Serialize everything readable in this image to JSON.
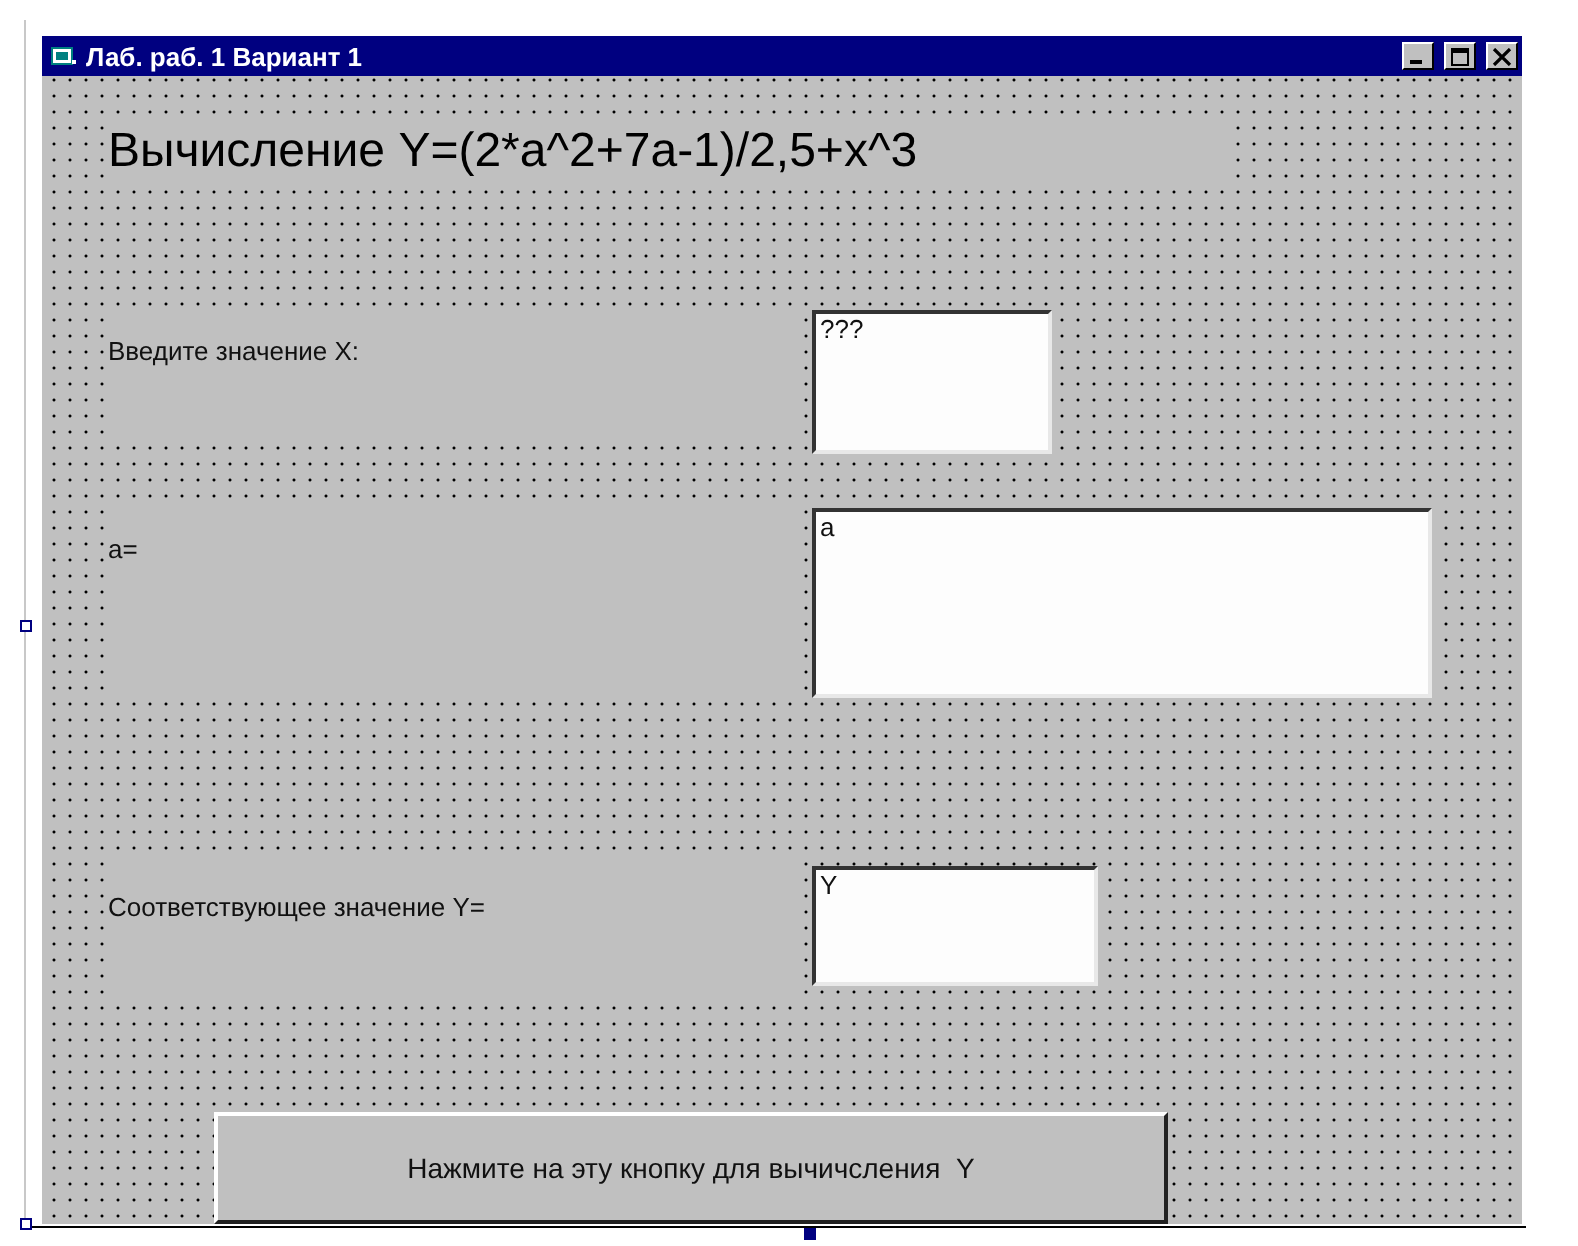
{
  "window": {
    "title": "Лаб. раб. 1 Вариант 1"
  },
  "heading": "Вычисление Y=(2*a^2+7a-1)/2,5+x^3",
  "fields": [
    {
      "kind": "small",
      "label": "Введите значение X:",
      "value": "???"
    },
    {
      "kind": "wide",
      "label": "a=",
      "value": "a"
    },
    {
      "kind": "medium",
      "label": "Соответствующее значение Y=",
      "value": "Y"
    }
  ],
  "button": "Нажмите на эту кнопку для вычичсления  Y"
}
